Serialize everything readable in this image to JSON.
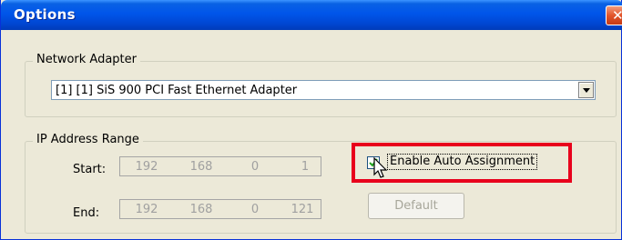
{
  "window": {
    "title": "Options",
    "close_glyph": "✕"
  },
  "network_adapter": {
    "legend": "Network Adapter",
    "selected": "[1] [1] SiS 900 PCI Fast Ethernet Adapter"
  },
  "ip_range": {
    "legend": "IP Address Range",
    "start_label": "Start:",
    "start": [
      "192",
      "168",
      "0",
      "1"
    ],
    "end_label": "End:",
    "end": [
      "192",
      "168",
      "0",
      "121"
    ]
  },
  "auto_assignment": {
    "label": "Enable Auto Assignment",
    "checked": true
  },
  "default_button": {
    "label": "Default"
  },
  "colors": {
    "highlight": "#e8001c",
    "title_bar": "#0055ea"
  }
}
